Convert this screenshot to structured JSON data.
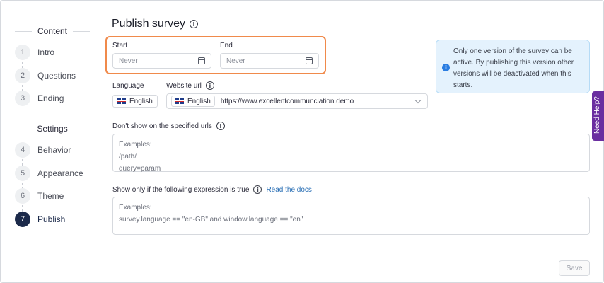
{
  "sidebar": {
    "content_heading": "Content",
    "settings_heading": "Settings",
    "steps": [
      {
        "num": "1",
        "label": "Intro"
      },
      {
        "num": "2",
        "label": "Questions"
      },
      {
        "num": "3",
        "label": "Ending"
      },
      {
        "num": "4",
        "label": "Behavior"
      },
      {
        "num": "5",
        "label": "Appearance"
      },
      {
        "num": "6",
        "label": "Theme"
      },
      {
        "num": "7",
        "label": "Publish"
      }
    ],
    "active_step": "Publish"
  },
  "main": {
    "title": "Publish survey",
    "start_label": "Start",
    "start_placeholder": "Never",
    "end_label": "End",
    "end_placeholder": "Never",
    "info_text": "Only one version of the survey can be active. By publishing this version other versions will be deactivated when this starts.",
    "language_label": "Language",
    "language_value": "English",
    "website_url_label": "Website url",
    "url_language": "English",
    "url_value": "https://www.excellentcommunciation.demo",
    "dont_show_label": "Don't show on the specified urls",
    "dont_show_lines": [
      "Examples:",
      "/path/",
      "query=param"
    ],
    "expression_label": "Show only if the following expression is true",
    "read_docs_link": "Read the docs",
    "expression_lines": [
      "Examples:",
      "survey.language == \"en-GB\" and window.language == \"en\""
    ],
    "save_label": "Save"
  },
  "help_tab_label": "Need Help?",
  "colors": {
    "accent_highlight": "#f08a4b",
    "active_step": "#1c2a4a",
    "info_bg": "#e4f2fd",
    "link": "#2a6fb5",
    "help_tab": "#6a2ea0"
  }
}
